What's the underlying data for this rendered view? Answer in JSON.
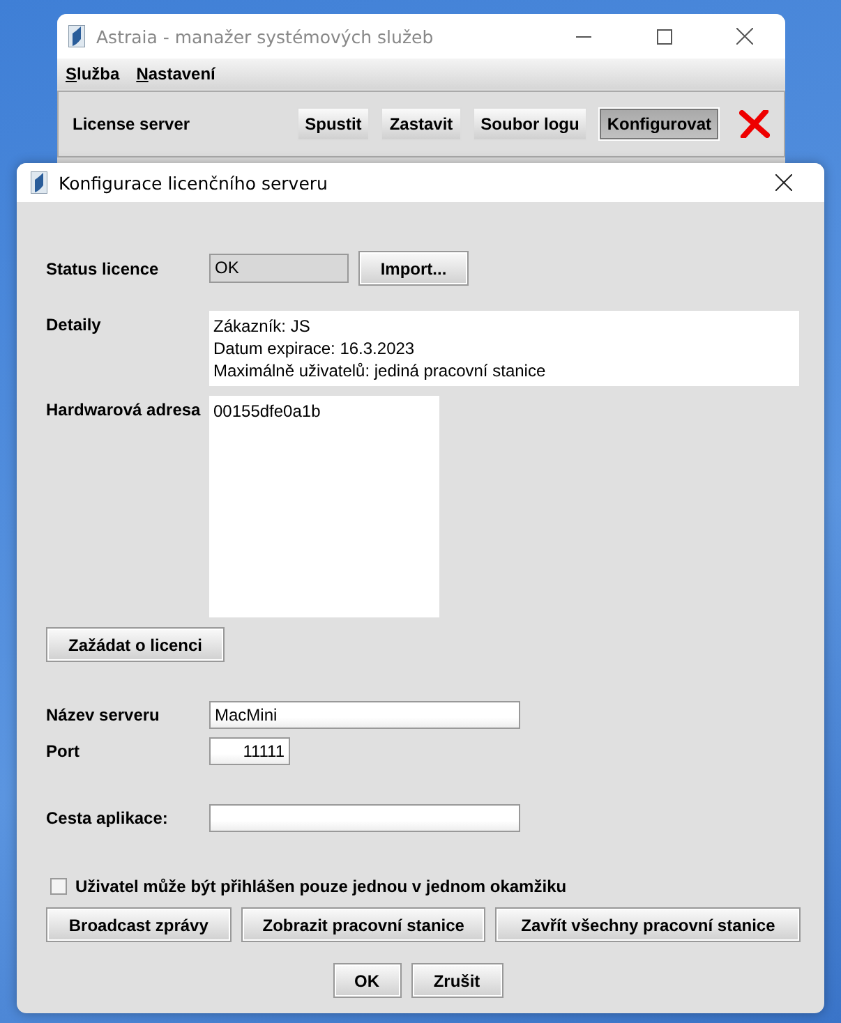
{
  "main_window": {
    "title": "Astraia - manažer systémových služeb",
    "menu": [
      "Služba",
      "Nastavení"
    ],
    "service": {
      "name": "License server",
      "buttons": [
        {
          "label": "Spustit",
          "selected": false
        },
        {
          "label": "Zastavit",
          "selected": false
        },
        {
          "label": "Soubor logu",
          "selected": false
        },
        {
          "label": "Konfigurovat",
          "selected": true
        }
      ]
    }
  },
  "dialog": {
    "title": "Konfigurace licenčního serveru",
    "status": {
      "label": "Status licence",
      "value": "OK",
      "button": "Import..."
    },
    "details": {
      "label": "Detaily",
      "lines": [
        "Zákazník: JS",
        "Datum expirace: 16.3.2023",
        "Maximálně uživatelů: jediná pracovní stanice"
      ]
    },
    "hardware": {
      "label": "Hardwarová adresa",
      "value": "00155dfe0a1b"
    },
    "request_button": "Zažádat o licenci",
    "server_name": {
      "label": "Název serveru",
      "value": "MacMini"
    },
    "port": {
      "label": "Port",
      "value": "11111"
    },
    "app_path": {
      "label": "Cesta aplikace:"
    },
    "single_login": {
      "label": "Uživatel může být přihlášen pouze jednou v jednom okamžiku",
      "checked": false
    },
    "actions": [
      "Broadcast zprávy",
      "Zobrazit pracovní stanice",
      "Zavřít všechny pracovní stanice"
    ],
    "buttons": [
      "OK",
      "Zrušit"
    ]
  }
}
